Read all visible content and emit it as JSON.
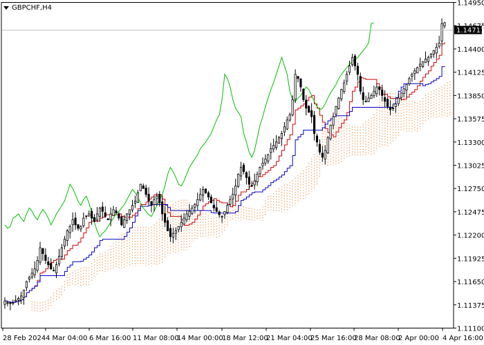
{
  "chart_data": {
    "type": "candlestick",
    "symbol": "GBPCHF,H4",
    "current_price": "1.14713",
    "ylim": [
      1.111,
      1.1495
    ],
    "y_ticks": [
      "1.14950",
      "1.14675",
      "1.14400",
      "1.14125",
      "1.13850",
      "1.13575",
      "1.13300",
      "1.13025",
      "1.12750",
      "1.12475",
      "1.12200",
      "1.11925",
      "1.11650",
      "1.11375",
      "1.11100"
    ],
    "x_ticks": [
      "28 Feb 2024",
      "4 Mar 04:00",
      "6 Mar 16:00",
      "11 Mar 08:00",
      "14 Mar 00:00",
      "18 Mar 12:00",
      "21 Mar 04:00",
      "25 Mar 16:00",
      "28 Mar 08:00",
      "2 Apr 00:00",
      "4 Apr 16:00"
    ],
    "series": [
      {
        "name": "price",
        "style": "candles",
        "color": "#000000",
        "close": [
          1.1142,
          1.114,
          1.1139,
          1.114,
          1.1143,
          1.1145,
          1.1148,
          1.1155,
          1.1165,
          1.117,
          1.1175,
          1.118,
          1.119,
          1.1205,
          1.1198,
          1.119,
          1.1185,
          1.118,
          1.1178,
          1.1185,
          1.1195,
          1.1205,
          1.1215,
          1.1225,
          1.123,
          1.1238,
          1.1232,
          1.1228,
          1.123,
          1.124,
          1.1242,
          1.1245,
          1.124,
          1.1236,
          1.1245,
          1.1252,
          1.1248,
          1.1242,
          1.1238,
          1.1245,
          1.125,
          1.1246,
          1.124,
          1.1232,
          1.1238,
          1.1245,
          1.125,
          1.1255,
          1.126,
          1.127,
          1.128,
          1.1275,
          1.1268,
          1.126,
          1.1255,
          1.1262,
          1.1266,
          1.1258,
          1.1245,
          1.1235,
          1.1225,
          1.1218,
          1.1222,
          1.1225,
          1.123,
          1.1235,
          1.124,
          1.1245,
          1.1248,
          1.1252,
          1.1256,
          1.1262,
          1.1268,
          1.1274,
          1.127,
          1.1265,
          1.1258,
          1.1252,
          1.1248,
          1.1244,
          1.1242,
          1.1248,
          1.1255,
          1.1262,
          1.1268,
          1.1278,
          1.1292,
          1.13,
          1.1295,
          1.1288,
          1.128,
          1.1278,
          1.1284,
          1.1292,
          1.13,
          1.1305,
          1.131,
          1.1315,
          1.1322,
          1.1326,
          1.133,
          1.1335,
          1.134,
          1.1348,
          1.1356,
          1.1362,
          1.138,
          1.141,
          1.1405,
          1.1395,
          1.138,
          1.137,
          1.1365,
          1.136,
          1.134,
          1.133,
          1.1318,
          1.1312,
          1.132,
          1.1335,
          1.135,
          1.136,
          1.1372,
          1.1382,
          1.1392,
          1.14,
          1.141,
          1.142,
          1.143,
          1.142,
          1.141,
          1.139,
          1.138,
          1.1378,
          1.1382,
          1.1385,
          1.139,
          1.1395,
          1.1392,
          1.1385,
          1.1378,
          1.1372,
          1.1368,
          1.137,
          1.1375,
          1.1382,
          1.1388,
          1.1393,
          1.1398,
          1.1405,
          1.141,
          1.1414,
          1.1418,
          1.1422,
          1.1425,
          1.1428,
          1.143,
          1.1434,
          1.1438,
          1.1442,
          1.1447,
          1.147,
          1.1471
        ]
      },
      {
        "name": "tenkan-sen",
        "color": "#d00000"
      },
      {
        "name": "kijun-sen",
        "color": "#0000c8"
      },
      {
        "name": "chikou span",
        "color": "#00c000"
      },
      {
        "name": "kumo cloud",
        "color": "#f4a460"
      }
    ],
    "grid": false
  }
}
